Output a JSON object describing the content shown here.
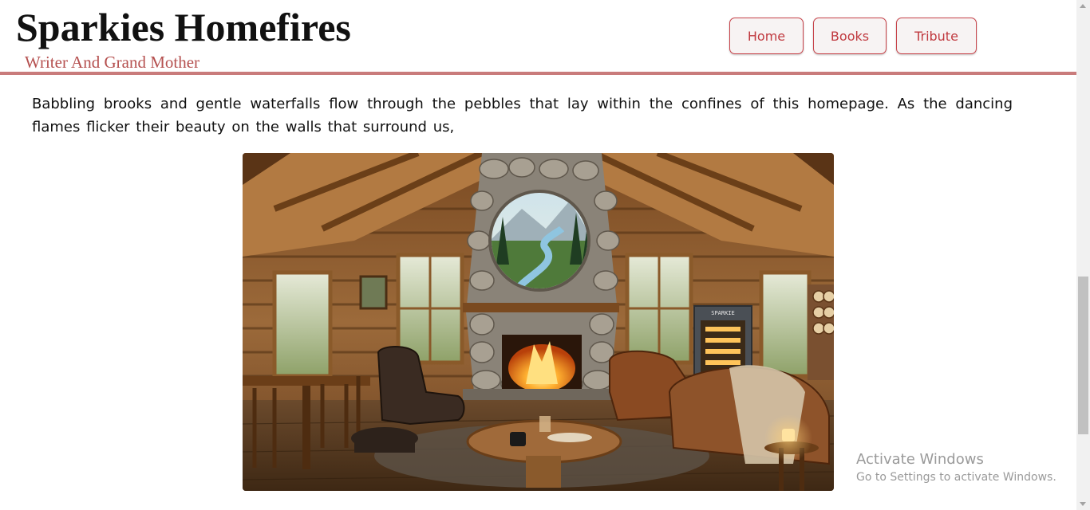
{
  "site": {
    "title": "Sparkies Homefires",
    "subtitle": "Writer And Grand Mother"
  },
  "nav": {
    "items": [
      {
        "label": "Home"
      },
      {
        "label": "Books"
      },
      {
        "label": "Tribute"
      }
    ]
  },
  "main": {
    "intro": "Babbling brooks and gentle waterfalls flow through the pebbles that lay within the confines of this homepage. As the dancing flames flicker their beauty on the walls that surround us,",
    "hero_image": {
      "cabinet_label": "SPARKIE"
    }
  },
  "watermark": {
    "title": "Activate Windows",
    "subtitle": "Go to Settings to activate Windows."
  },
  "colors": {
    "accent": "#c0393f",
    "subtitle": "#b5504f",
    "rule": "#c97b7b"
  }
}
